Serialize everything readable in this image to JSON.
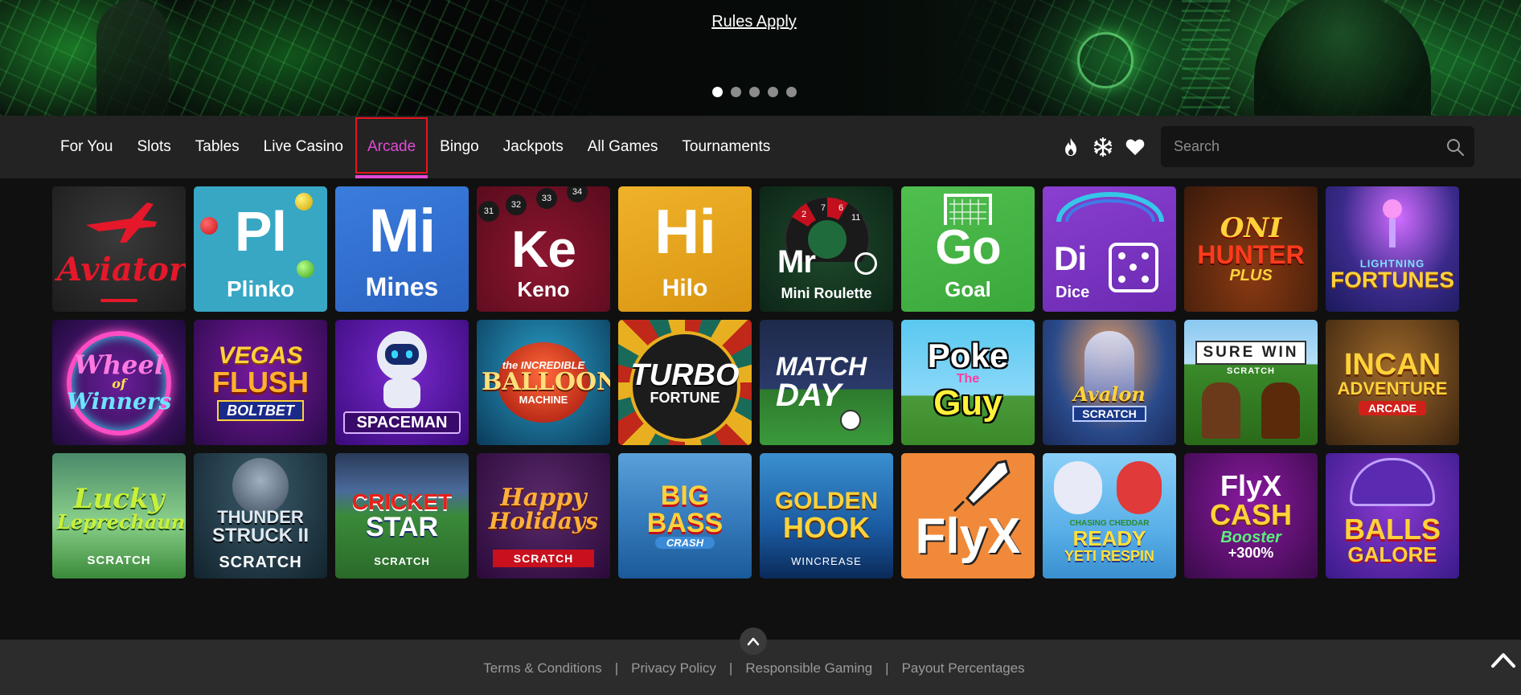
{
  "banner": {
    "rules_link": "Rules Apply",
    "slides": 5,
    "active_slide": 0
  },
  "nav": {
    "items": [
      {
        "label": "For You"
      },
      {
        "label": "Slots"
      },
      {
        "label": "Tables"
      },
      {
        "label": "Live Casino"
      },
      {
        "label": "Arcade",
        "active": true
      },
      {
        "label": "Bingo"
      },
      {
        "label": "Jackpots"
      },
      {
        "label": "All Games"
      },
      {
        "label": "Tournaments"
      }
    ],
    "icons": [
      "fire-icon",
      "snowflake-icon",
      "heart-icon"
    ],
    "search_placeholder": "Search"
  },
  "colors": {
    "accent": "#e14bd6",
    "focus_outline": "#e8141f",
    "nav_bg": "#232323",
    "page_bg": "#101010",
    "footer_bg": "#2c2c2c"
  },
  "games": [
    {
      "name": "Aviator",
      "title": "Aviator"
    },
    {
      "name": "Plinko",
      "abbr": "Pl",
      "title": "Plinko"
    },
    {
      "name": "Mines",
      "abbr": "Mi",
      "title": "Mines"
    },
    {
      "name": "Keno",
      "abbr": "Ke",
      "title": "Keno",
      "balls": [
        "31",
        "32",
        "33",
        "34"
      ]
    },
    {
      "name": "Hilo",
      "abbr": "Hi",
      "title": "Hilo"
    },
    {
      "name": "Mini Roulette",
      "abbr": "Mr",
      "title": "Mini Roulette",
      "numbers": [
        "2",
        "7",
        "6",
        "11"
      ]
    },
    {
      "name": "Goal",
      "abbr": "Go",
      "title": "Goal"
    },
    {
      "name": "Dice",
      "abbr": "Di",
      "title": "Dice"
    },
    {
      "name": "Oni Hunter Plus",
      "line1": "ONI",
      "line2": "HUNTER",
      "line3": "PLUS"
    },
    {
      "name": "Lightning Fortunes",
      "line1": "LIGHTNING",
      "line2": "FORTUNES"
    },
    {
      "name": "Wheel of Winners",
      "line1": "Wheel",
      "line2": "of",
      "line3": "Winners"
    },
    {
      "name": "Vegas Flush Boltbet",
      "line1": "VEGAS",
      "line2": "FLUSH",
      "line3": "BOLTBET"
    },
    {
      "name": "Spaceman",
      "line1": "SPACEMAN"
    },
    {
      "name": "The Incredible Balloon Machine",
      "line1": "the INCREDIBLE",
      "line2": "BALLOON",
      "line3": "MACHINE"
    },
    {
      "name": "Turbo Fortune",
      "line1": "TURBO",
      "line2": "FORTUNE"
    },
    {
      "name": "Match Day",
      "line1": "MATCH",
      "line2": "DAY"
    },
    {
      "name": "Poke The Guy",
      "line1": "Poke",
      "line2": "The",
      "line3": "Guy"
    },
    {
      "name": "Avalon Scratch",
      "line1": "Avalon",
      "line2": "SCRATCH"
    },
    {
      "name": "Sure Win Scratch",
      "line1": "SURE WIN",
      "line2": "SCRATCH"
    },
    {
      "name": "Incan Adventure Arcade",
      "line1": "INCAN",
      "line2": "ADVENTURE",
      "line3": "ARCADE"
    },
    {
      "name": "Lucky Leprechaun Scratch",
      "line1": "Lucky",
      "line2": "Leprechaun",
      "line3": "SCRATCH"
    },
    {
      "name": "Thunderstruck II Scratch",
      "line1": "THUNDER",
      "line2": "STRUCK II",
      "line3": "SCRATCH"
    },
    {
      "name": "Cricket Star Scratch",
      "line1": "CRICKET",
      "line2": "STAR",
      "line3": "SCRATCH"
    },
    {
      "name": "Happy Holidays Scratch",
      "line1": "Happy",
      "line2": "Holidays",
      "line3": "SCRATCH"
    },
    {
      "name": "Big Bass Crash",
      "line1": "BIG BASS",
      "line2": "CRASH"
    },
    {
      "name": "Golden Hook",
      "line1": "GOLDEN",
      "line2": "HOOK",
      "line3": "WINCREASE"
    },
    {
      "name": "FlyX",
      "line1": "FlyX"
    },
    {
      "name": "Chasing Cheddar Ready Yeti Respin",
      "line1": "CHASING CHEDDAR",
      "line2": "READY",
      "line3": "YETI RESPIN"
    },
    {
      "name": "FlyX Cash Booster",
      "line1": "FlyX",
      "line2": "CASH",
      "line3": "Booster",
      "line4": "+300%"
    },
    {
      "name": "Balls Galore",
      "line1": "BALLS",
      "line2": "GALORE"
    }
  ],
  "footer": {
    "links": [
      "Terms & Conditions",
      "Privacy Policy",
      "Responsible Gaming",
      "Payout Percentages"
    ],
    "separator": "|"
  }
}
